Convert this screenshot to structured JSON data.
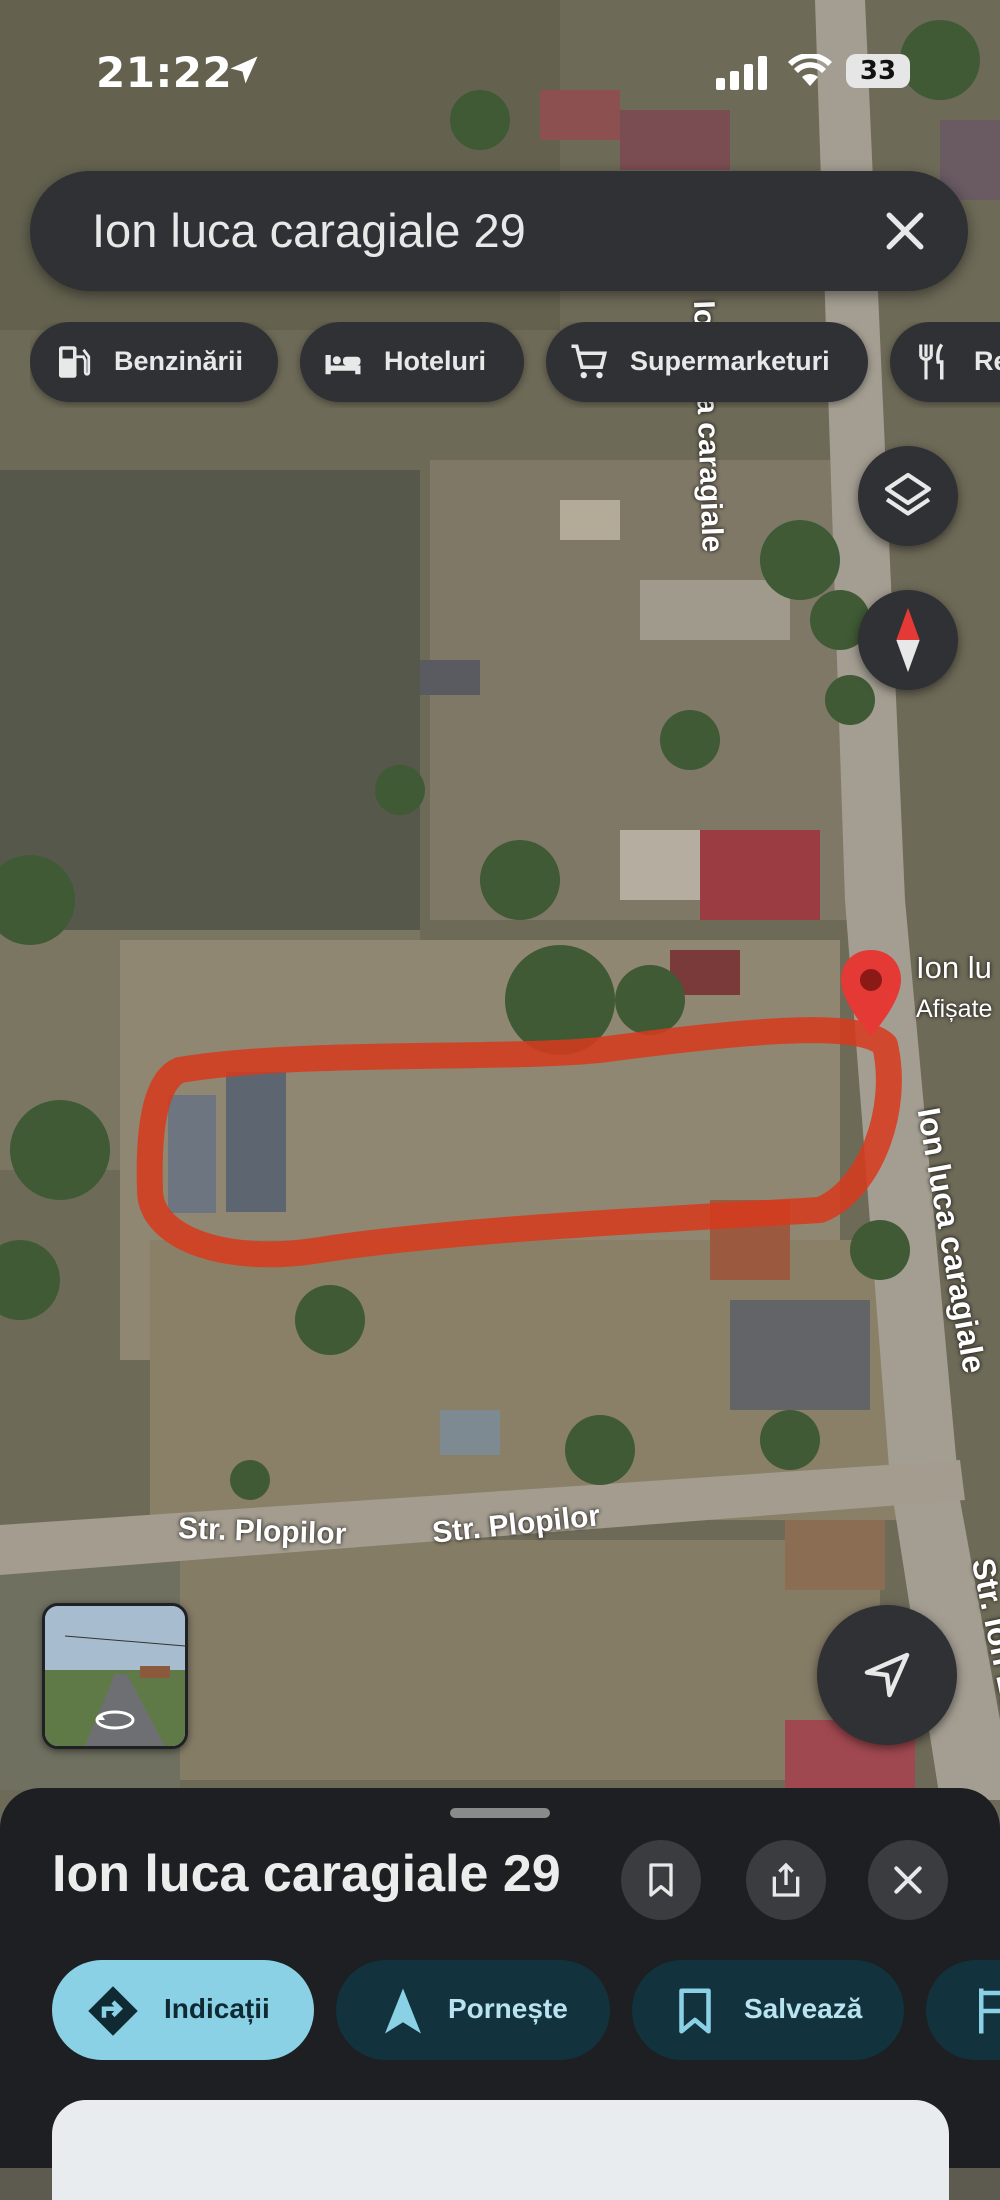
{
  "status_bar": {
    "time": "21:22",
    "battery": "33"
  },
  "search": {
    "query": "Ion luca caragiale 29"
  },
  "chips": [
    {
      "label": "Benzinării",
      "icon": "gas-station-icon"
    },
    {
      "label": "Hoteluri",
      "icon": "bed-icon"
    },
    {
      "label": "Supermarketuri",
      "icon": "cart-icon"
    },
    {
      "label": "Re",
      "icon": "restaurant-icon"
    }
  ],
  "map": {
    "street_labels": [
      "Str. Plopilor",
      "Str. Plopilor",
      "Ion luca caragiale",
      "Ion luca caragiale",
      "Str. Ion Luca Cara"
    ],
    "pin": {
      "title": "Ion lu",
      "subtitle": "Afișate"
    },
    "annotation_color": "#d83a1c"
  },
  "place_sheet": {
    "title": "Ion luca caragiale 29",
    "actions": [
      {
        "label": "Indicații",
        "icon": "directions-icon"
      },
      {
        "label": "Pornește",
        "icon": "navigation-arrow-icon"
      },
      {
        "label": "Salvează",
        "icon": "bookmark-icon"
      }
    ]
  },
  "colors": {
    "accent": "#8bd1e6",
    "panel": "#2f3134",
    "sheet": "#1e1f22",
    "pin": "#e53935"
  }
}
